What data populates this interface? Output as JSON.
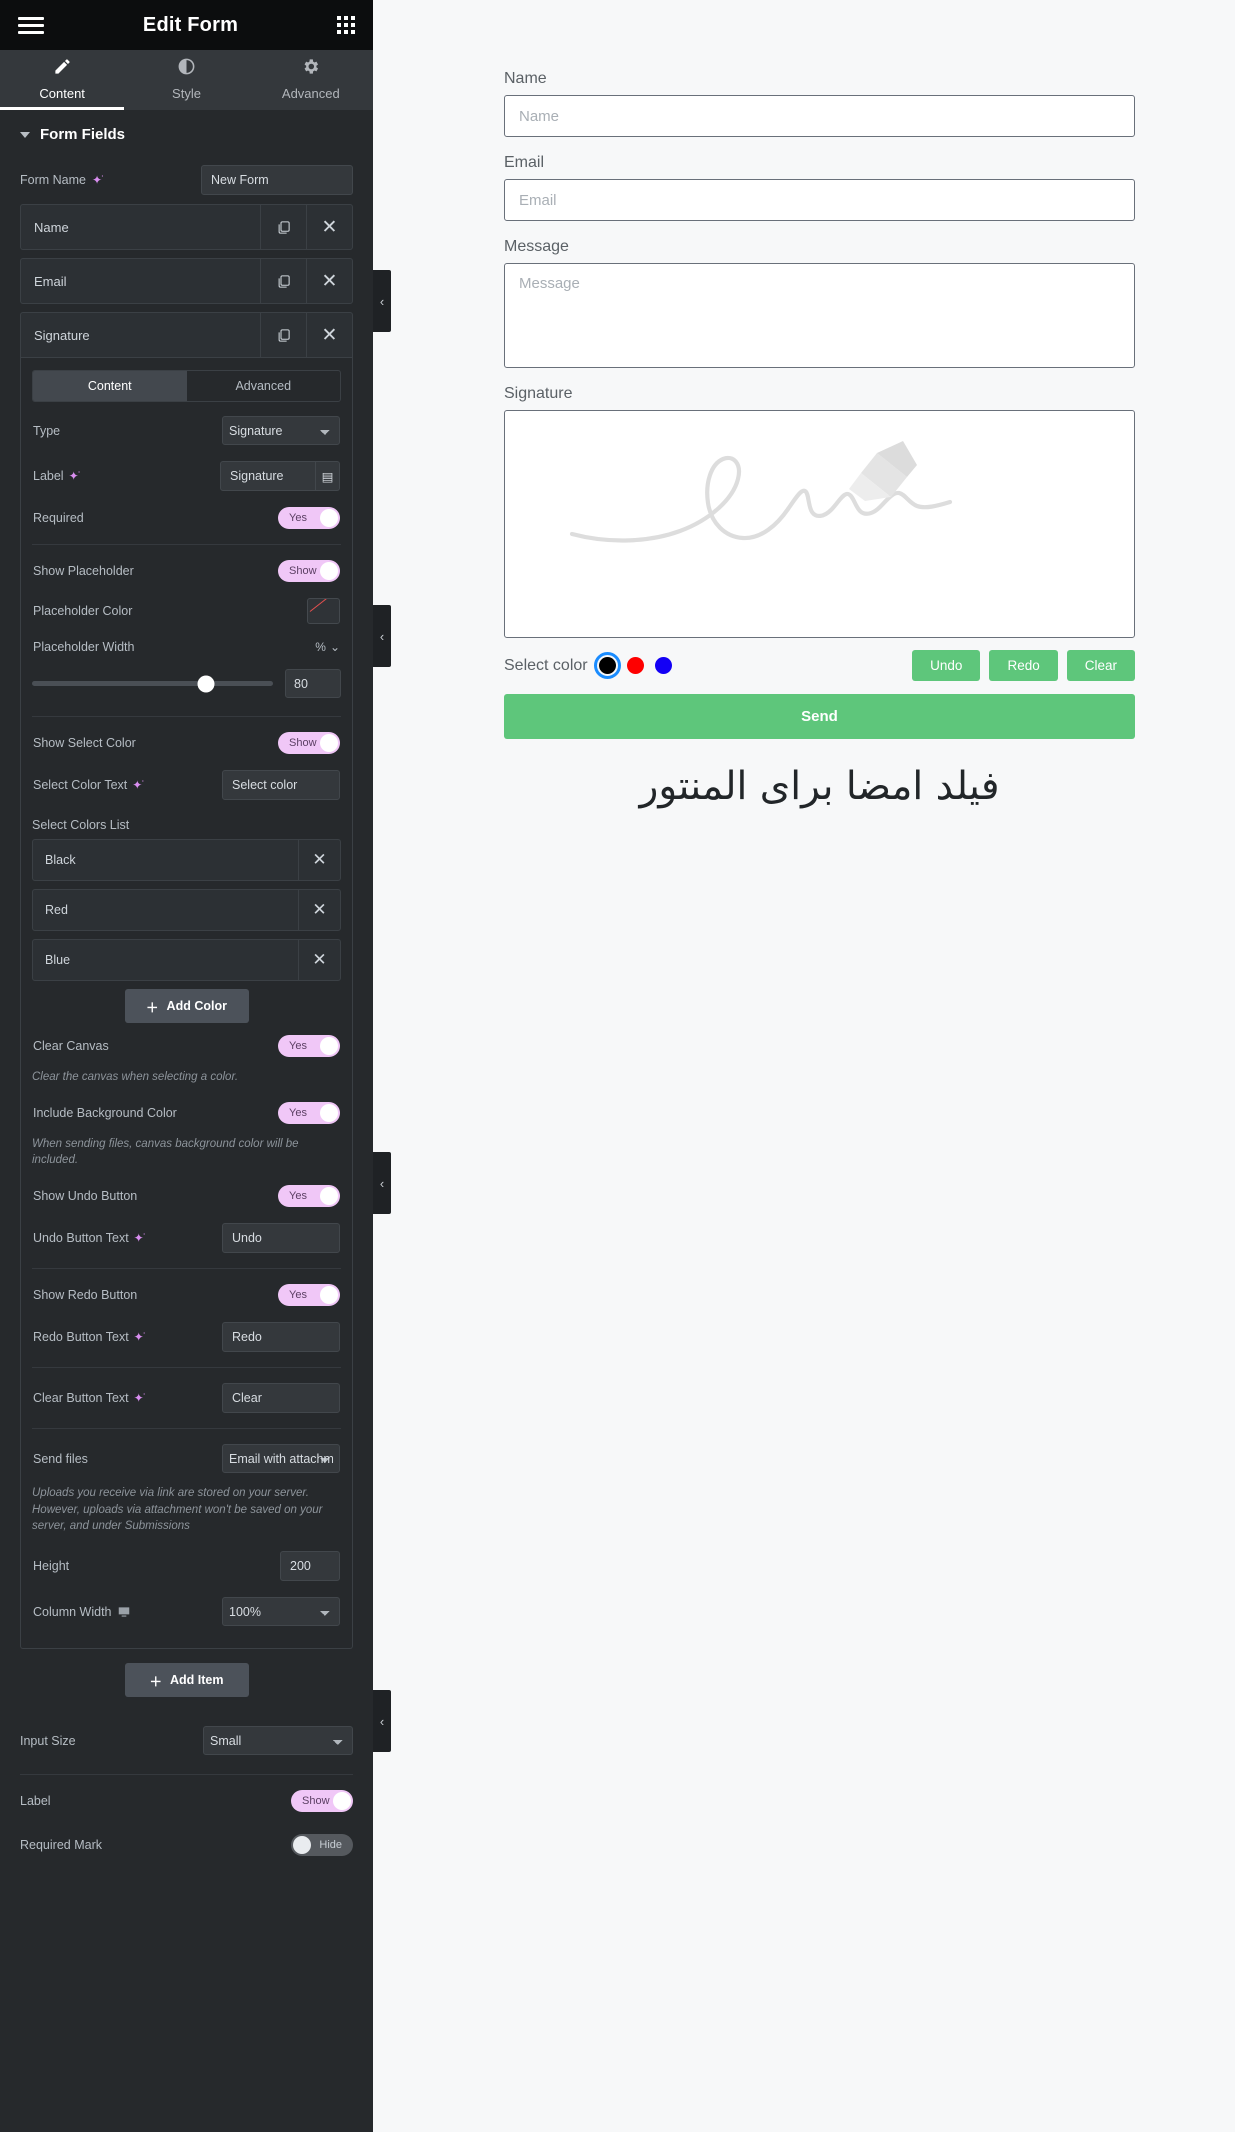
{
  "panel": {
    "title": "Edit Form",
    "menu_icon": "hamburger-icon",
    "apps_icon": "grid-apps-icon",
    "tabs": [
      {
        "label": "Content",
        "icon": "pencil-icon",
        "active": true
      },
      {
        "label": "Style",
        "icon": "contrast-icon",
        "active": false
      },
      {
        "label": "Advanced",
        "icon": "gear-icon",
        "active": false
      }
    ],
    "section_title": "Form Fields",
    "form_name_label": "Form Name",
    "form_name_value": "New Form",
    "fields": [
      {
        "label": "Name"
      },
      {
        "label": "Email"
      },
      {
        "label": "Signature"
      }
    ],
    "editor": {
      "subtabs": [
        {
          "label": "Content",
          "active": true
        },
        {
          "label": "Advanced",
          "active": false
        }
      ],
      "type_label": "Type",
      "type_value": "Signature",
      "label_label": "Label",
      "label_value": "Signature",
      "required_label": "Required",
      "required_toggle": "Yes",
      "show_placeholder_label": "Show Placeholder",
      "show_placeholder_toggle": "Show",
      "placeholder_color_label": "Placeholder Color",
      "placeholder_width_label": "Placeholder Width",
      "placeholder_width_unit": "%",
      "placeholder_width_value": "80",
      "show_select_color_label": "Show Select Color",
      "show_select_color_toggle": "Show",
      "select_color_text_label": "Select Color Text",
      "select_color_text_value": "Select color",
      "select_colors_list_label": "Select Colors List",
      "colors": [
        {
          "name": "Black"
        },
        {
          "name": "Red"
        },
        {
          "name": "Blue"
        }
      ],
      "add_color_label": "Add Color",
      "clear_canvas_label": "Clear Canvas",
      "clear_canvas_toggle": "Yes",
      "clear_canvas_hint": "Clear the canvas when selecting a color.",
      "include_bg_label": "Include Background Color",
      "include_bg_toggle": "Yes",
      "include_bg_hint": "When sending files, canvas background color will be included.",
      "show_undo_label": "Show Undo Button",
      "show_undo_toggle": "Yes",
      "undo_text_label": "Undo Button Text",
      "undo_text_value": "Undo",
      "show_redo_label": "Show Redo Button",
      "show_redo_toggle": "Yes",
      "redo_text_label": "Redo Button Text",
      "redo_text_value": "Redo",
      "clear_text_label": "Clear Button Text",
      "clear_text_value": "Clear",
      "send_files_label": "Send files",
      "send_files_value": "Email with attachment",
      "send_files_hint": "Uploads you receive via link are stored on your server. However, uploads via attachment won't be saved on your server, and under Submissions",
      "height_label": "Height",
      "height_value": "200",
      "column_width_label": "Column Width",
      "column_width_value": "100%"
    },
    "add_item_label": "Add Item",
    "input_size_label": "Input Size",
    "input_size_value": "Small",
    "label_row_label": "Label",
    "label_row_toggle": "Show",
    "required_mark_label": "Required Mark",
    "required_mark_toggle": "Hide"
  },
  "preview": {
    "name_label": "Name",
    "name_placeholder": "Name",
    "email_label": "Email",
    "email_placeholder": "Email",
    "message_label": "Message",
    "message_placeholder": "Message",
    "signature_label": "Signature",
    "select_color_text": "Select color",
    "colors": [
      {
        "name": "black",
        "hex": "#000000",
        "selected": true
      },
      {
        "name": "red",
        "hex": "#fe0000",
        "selected": false
      },
      {
        "name": "blue",
        "hex": "#1300f5",
        "selected": false
      }
    ],
    "undo_label": "Undo",
    "redo_label": "Redo",
    "clear_label": "Clear",
    "send_label": "Send",
    "heading_rtl": "فیلد امضا برای المنتور",
    "accent_green": "#5ec67b",
    "accent_pink": "#f0c7f7"
  }
}
